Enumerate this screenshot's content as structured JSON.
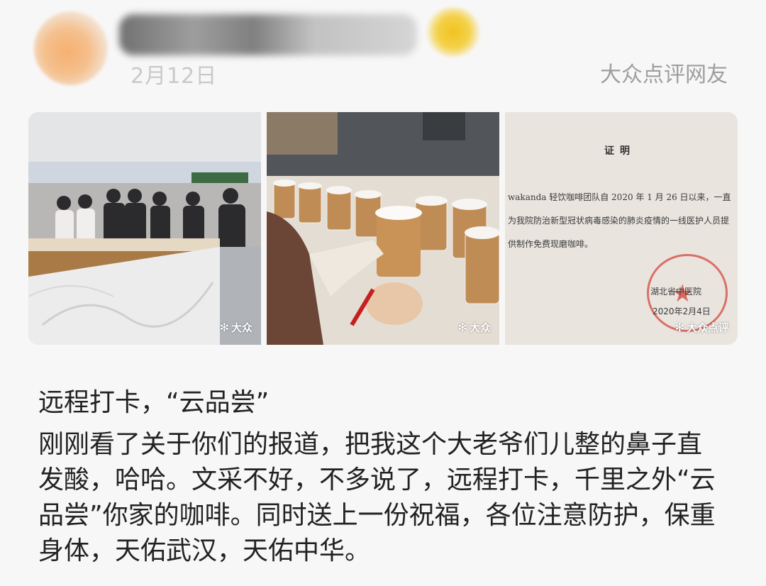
{
  "post": {
    "date": "2月12日",
    "source": "大众点评网友",
    "title": "远程打卡，“云品尝”",
    "body": "刚刚看了关于你们的报道，把我这个大老爷们儿整的鼻子直发酸，哈哈。文采不好，不多说了，远程打卡，千里之外“云品尝”你家的咖啡。同时送上一份祝福，各位注意防护，保重身体，天佑武汉，天佑中华。"
  },
  "photos": [
    {
      "watermark": "大众"
    },
    {
      "watermark": "大众"
    },
    {
      "watermark": "大众点评"
    }
  ],
  "certificate": {
    "title": "证明",
    "body": "wakanda 轻饮咖啡团队自 2020 年 1 月 26 日以来，一直为我院防治新型冠状病毒感染的肺炎疫情的一线医护人员提供制作免费现磨咖啡。",
    "seal_text": "湖北省中医院",
    "seal_date": "2020年2月4日"
  },
  "icons": {
    "watermark": "dianping-logo-icon"
  }
}
